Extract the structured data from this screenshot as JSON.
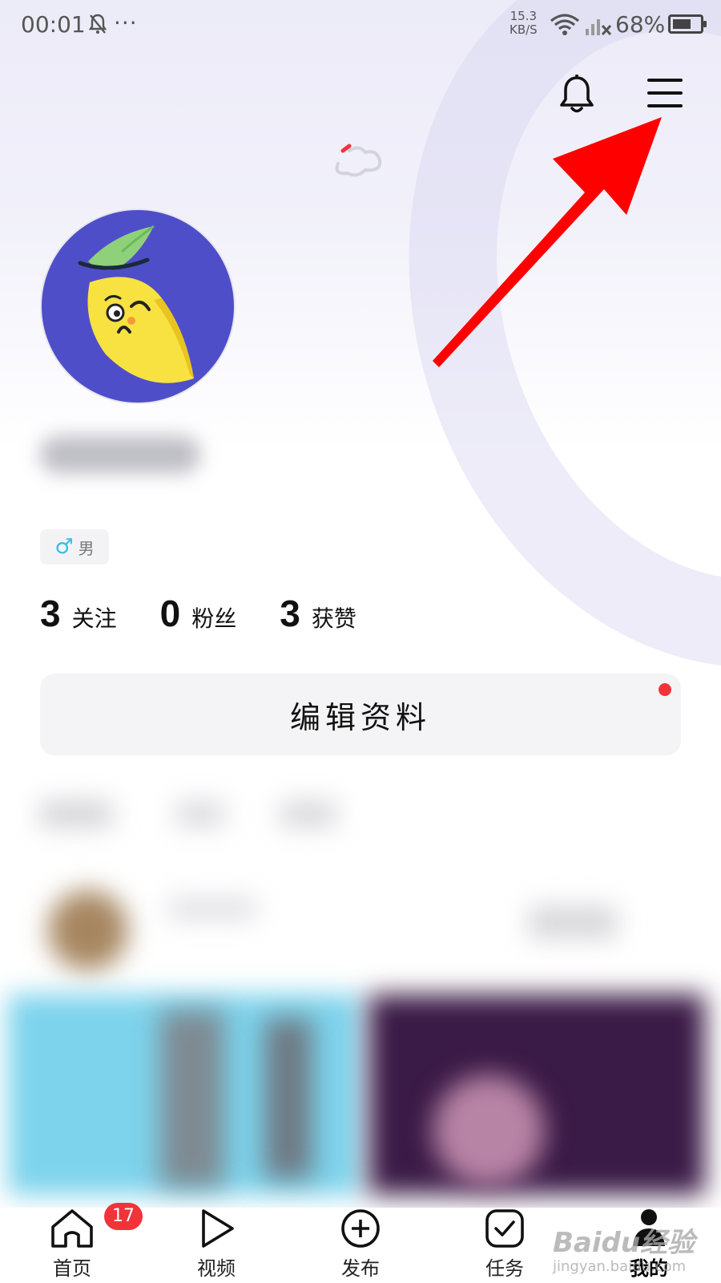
{
  "status_bar": {
    "time": "00:01",
    "more": "···",
    "net_speed_value": "15.3",
    "net_speed_unit": "KB/S",
    "battery_text": "68%",
    "battery_level": 0.68
  },
  "profile": {
    "gender": "男",
    "stats": [
      {
        "num": "3",
        "label": "关注"
      },
      {
        "num": "0",
        "label": "粉丝"
      },
      {
        "num": "3",
        "label": "获赞"
      }
    ],
    "edit_button": "编辑资料"
  },
  "colors": {
    "accent_red": "#f0343a",
    "annotation_arrow": "#ff0000",
    "avatar_bg": "#4f4ec9",
    "gender_icon": "#33bde8"
  },
  "tab_bar": {
    "home_badge": "17",
    "items": [
      {
        "label": "首页",
        "icon": "home-icon"
      },
      {
        "label": "视频",
        "icon": "play-icon"
      },
      {
        "label": "发布",
        "icon": "plus-circle-icon"
      },
      {
        "label": "任务",
        "icon": "task-check-icon"
      },
      {
        "label": "我的",
        "icon": "profile-icon"
      }
    ]
  },
  "watermark": {
    "brand": "Baidu经验",
    "url": "jingyan.baidu.com"
  }
}
